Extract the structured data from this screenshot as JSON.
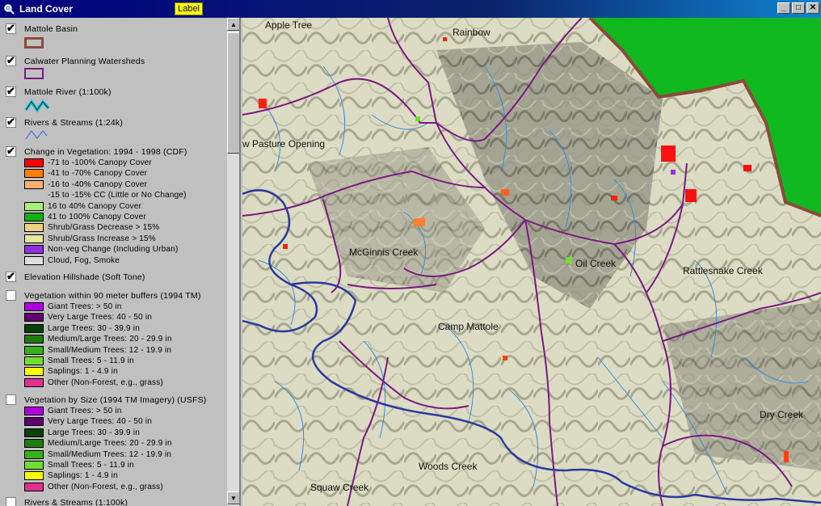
{
  "window": {
    "title": "Land Cover",
    "badge": "Label",
    "controls": [
      "_",
      "□",
      "✕"
    ]
  },
  "layers": [
    {
      "id": "basin",
      "name": "Mattole Basin",
      "checked": true,
      "symbol": "polygon-brown"
    },
    {
      "id": "calwater",
      "name": "Calwater Planning Watersheds",
      "checked": true,
      "symbol": "polygon-purple"
    },
    {
      "id": "river",
      "name": "Mattole River (1:100k)",
      "checked": true,
      "symbol": "line-cyan"
    },
    {
      "id": "streams",
      "name": "Rivers & Streams (1:24k)",
      "checked": true,
      "symbol": "line-blue"
    },
    {
      "id": "change",
      "name": "Change in Vegetation: 1994 - 1998 (CDF)",
      "checked": true,
      "legend": [
        {
          "label": "-71 to -100% Canopy Cover",
          "color": "#ff0000"
        },
        {
          "label": "-41 to -70% Canopy Cover",
          "color": "#ff7f00"
        },
        {
          "label": "-16 to -40% Canopy Cover",
          "color": "#ffb070"
        },
        {
          "label": "-15 to -15% CC (Little or No Change)",
          "color": null
        },
        {
          "label": "16 to 40% Canopy Cover",
          "color": "#a8f07c"
        },
        {
          "label": "41 to 100% Canopy Cover",
          "color": "#10b010"
        },
        {
          "label": "Shrub/Grass Decrease > 15%",
          "color": "#f0d080"
        },
        {
          "label": "Shrub/Grass Increase > 15%",
          "color": "#e8e8a0"
        },
        {
          "label": "Non-veg Change (Including Urban)",
          "color": "#9030e0"
        },
        {
          "label": "Cloud, Fog, Smoke",
          "color": "#e0e0e0"
        }
      ]
    },
    {
      "id": "hillshade",
      "name": "Elevation Hillshade (Soft Tone)",
      "checked": true
    },
    {
      "id": "veg90",
      "name": "Vegetation within 90 meter buffers (1994 TM)",
      "checked": false,
      "legend": [
        {
          "label": "Giant Trees: > 50 in",
          "color": "#b000e0"
        },
        {
          "label": "Very Large Trees: 40 - 50 in",
          "color": "#600070"
        },
        {
          "label": "Large Trees: 30 - 39.9 in",
          "color": "#084008"
        },
        {
          "label": "Medium/Large Trees: 20 - 29.9 in",
          "color": "#207a10"
        },
        {
          "label": "Small/Medium Trees: 12 - 19.9 in",
          "color": "#38b018"
        },
        {
          "label": "Small Trees: 5 - 11.9 in",
          "color": "#70e030"
        },
        {
          "label": "Saplings: 1 - 4.9 in",
          "color": "#ffff00"
        },
        {
          "label": "Other (Non-Forest, e.g., grass)",
          "color": "#e03090"
        }
      ]
    },
    {
      "id": "vegsize",
      "name": "Vegetation by Size (1994 TM Imagery) (USFS)",
      "checked": false,
      "legend": [
        {
          "label": "Giant Trees: > 50 in",
          "color": "#b000e0"
        },
        {
          "label": "Very Large Trees: 40 - 50 in",
          "color": "#600070"
        },
        {
          "label": "Large Trees: 30 - 39.9 in",
          "color": "#084008"
        },
        {
          "label": "Medium/Large Trees: 20 - 29.9 in",
          "color": "#207a10"
        },
        {
          "label": "Small/Medium Trees: 12 - 19.9 in",
          "color": "#38b018"
        },
        {
          "label": "Small Trees: 5 - 11.9 in",
          "color": "#70e030"
        },
        {
          "label": "Saplings: 1 - 4.9 in",
          "color": "#ffff00"
        },
        {
          "label": "Other (Non-Forest, e.g., grass)",
          "color": "#e03090"
        }
      ]
    },
    {
      "id": "streams100k",
      "name": "Rivers & Streams (1:100k)",
      "checked": false
    }
  ],
  "map": {
    "places": [
      "Apple Tree",
      "Rainbow",
      "w Pasture Opening",
      "McGinnis Creek",
      "Oil Creek",
      "Rattlesnake Creek",
      "Camp Mattole",
      "Dry Creek",
      "Woods Creek",
      "Squaw Creek"
    ],
    "colors": {
      "ocean": "#10b820",
      "basin": "#8b4a3a",
      "watershed": "#7a1a80",
      "river": "#2a3aa0",
      "stream": "#3a8ad8",
      "terrain": "#d8d8c0"
    }
  },
  "scrollbar": {
    "up": "▲",
    "down": "▼"
  }
}
